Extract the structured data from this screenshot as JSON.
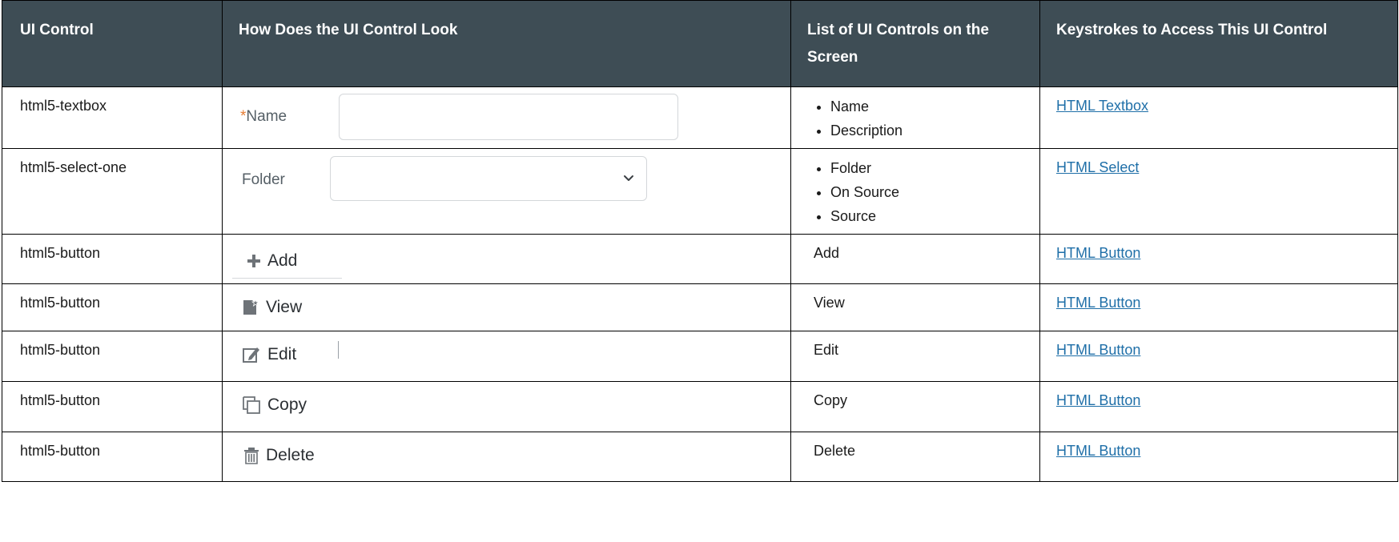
{
  "headers": {
    "ui_control": "UI Control",
    "look": "How Does the UI Control Look",
    "list": "List of UI Controls on the Screen",
    "keystrokes": "Keystrokes to Access This UI Control"
  },
  "rows": [
    {
      "control": "html5-textbox",
      "preview": {
        "required_mark": "*",
        "label": "Name",
        "input_value": ""
      },
      "list": [
        "Name",
        "Description"
      ],
      "link": " HTML Textbox"
    },
    {
      "control": "html5-select-one",
      "preview": {
        "label": "Folder",
        "selected_value": ""
      },
      "list": [
        "Folder",
        "On Source",
        "Source"
      ],
      "link": "HTML Select"
    },
    {
      "control": "html5-button",
      "preview": {
        "label": "Add",
        "icon": "plus-icon"
      },
      "list_text": "Add",
      "link": "HTML Button"
    },
    {
      "control": "html5-button",
      "preview": {
        "label": "View",
        "icon": "view-document-icon"
      },
      "list_text": "View",
      "link": "HTML Button"
    },
    {
      "control": "html5-button",
      "preview": {
        "label": "Edit",
        "icon": "edit-pencil-icon"
      },
      "list_text": "Edit",
      "link": "HTML Button"
    },
    {
      "control": "html5-button",
      "preview": {
        "label": "Copy",
        "icon": "copy-icon"
      },
      "list_text": "Copy",
      "link": "HTML Button"
    },
    {
      "control": "html5-button",
      "preview": {
        "label": "Delete",
        "icon": "trash-icon"
      },
      "list_text": "Delete",
      "link": "HTML Button"
    }
  ],
  "colors": {
    "header_bg": "#3e4d55",
    "header_text": "#ffffff",
    "link": "#1f6fa8",
    "required_star": "#e57c33",
    "icon_gray": "#6e7378"
  }
}
